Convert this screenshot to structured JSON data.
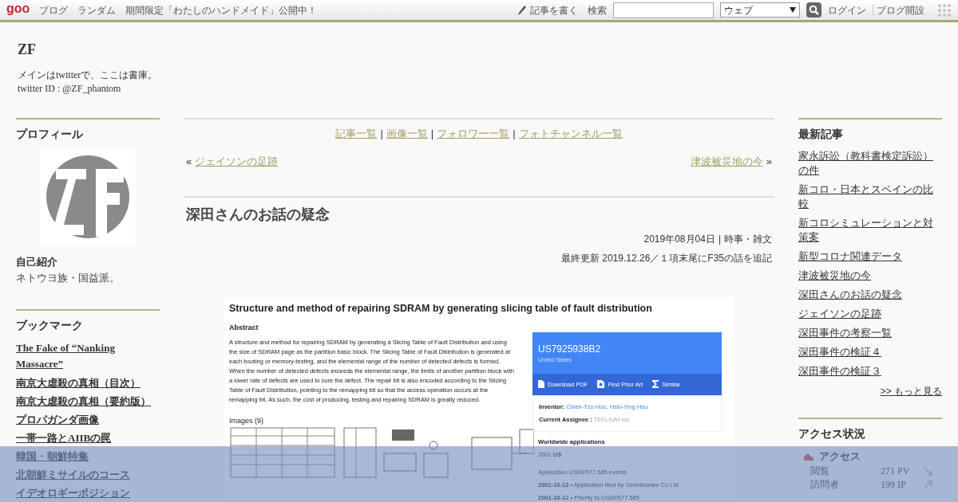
{
  "topbar": {
    "logo": "goo",
    "links": [
      "ブログ",
      "ランダム",
      "期間限定「わたしのハンドメイド」公開中！"
    ],
    "write": "記事を書く",
    "search_label": "検索",
    "search_scope": "ウェブ",
    "login": "ログイン",
    "open_blog": "ブログ開設"
  },
  "blog": {
    "title": "ZF",
    "description": [
      "メインはtwitterで、ここは書庫。",
      "twitter ID : @ZF_phantom"
    ]
  },
  "profile": {
    "heading": "プロフィール",
    "intro_heading": "自己紹介",
    "intro": "ネトウヨ族・国益派。"
  },
  "bookmarks": {
    "heading": "ブックマーク",
    "items": [
      {
        "label": "The Fake of “Nanking Massacre”",
        "kind": "latin"
      },
      {
        "label": "南京大虐殺の真相（目次）",
        "kind": "jp"
      },
      {
        "label": "南京大虐殺の真相（要約版）",
        "kind": "jp"
      },
      {
        "label": "プロパガンダ画像",
        "kind": "jp"
      },
      {
        "label": "一帯一路とAIIBの罠",
        "kind": "jp"
      },
      {
        "label": "韓国・朝鮮特集",
        "kind": "jp"
      },
      {
        "label": "北朝鮮ミサイルのコース",
        "kind": "jp"
      },
      {
        "label": "イデオロギーポジション",
        "kind": "jp"
      }
    ]
  },
  "nav_links": [
    "記事一覧",
    "画像一覧",
    "フォロワー一覧",
    "フォトチャンネル一覧"
  ],
  "nav_separator": "|",
  "prev": {
    "mark": "«",
    "label": "ジェイソンの足跡"
  },
  "next": {
    "label": "津波被災地の今",
    "mark": "»"
  },
  "article": {
    "title": "深田さんのお話の疑念",
    "date": "2019年08月04日",
    "separator": "|",
    "category": "時事・雑文",
    "updated": "最終更新 2019.12.26／１項末尾にF35の話を追記",
    "patent": {
      "title": "Structure and method of repairing SDRAM by generating slicing table of fault distribution",
      "abstract_heading": "Abstract",
      "abstract": "A structure and method for repairing SDRAM by generating a Slicing Table of Fault Distribution and using the size of SDRAM page as the partition basic block. The Slicing Table of Fault Distribution is generated at each booting or memory-testing, and the elemental range of the number of detected defects is formed. When the number of detected defects exceeds the elemental range, the limits of another partition block with a lower rate of defects are used to cure the defect. The repair bit is also encoded according to the Slicing Table of Fault Distribution, pointing to the remapping bit so that the access operation occurs at the remapping bit. As such, the cost of producing, testing and repairing SDRAM is greatly reduced.",
      "images_heading": "Images (9)",
      "number": "US7925938B2",
      "country": "United States",
      "actions": [
        {
          "label": "Download PDF",
          "kind": "pdf"
        },
        {
          "label": "Find Prior Art",
          "kind": "search"
        },
        {
          "label": "Similar",
          "kind": "sigma"
        }
      ],
      "inventor_label": "Inventor:",
      "inventors": "Chien-Tzu Hou, Hsiu-Ying Hsu",
      "assignee_label": "Current Assignee :",
      "assignee": "TEKLIUM Inc",
      "worldwide_heading": "Worldwide applications",
      "worldwide_year": "2001",
      "worldwide_country": "US",
      "events_heading": "Application US09/977,585 events",
      "bullet": "•",
      "events": [
        {
          "date": "2001-10-12",
          "text": "Application filed by Geneticware Co Ltd"
        },
        {
          "date": "2001-10-12",
          "text": "Priority to US09/977,585"
        }
      ]
    }
  },
  "recent": {
    "heading": "最新記事",
    "items": [
      "家永訴訟（教科書検定訴訟）の件",
      "新コロ・日本とスペインの比較",
      "新コロシミュレーションと対策案",
      "新型コロナ関連データ",
      "津波被災地の今",
      "深田さんのお話の疑念",
      "ジェイソンの足跡",
      "深田事件の考察一覧",
      "深田事件の検証４",
      "深田事件の検証３"
    ],
    "more": ">> もっと見る"
  },
  "access": {
    "heading": "アクセス状況",
    "sub": "アクセス",
    "rows": [
      {
        "label": "閲覧",
        "value": "271 PV",
        "kind": "down"
      },
      {
        "label": "訪問者",
        "value": "199 IP",
        "kind": "up"
      }
    ]
  }
}
